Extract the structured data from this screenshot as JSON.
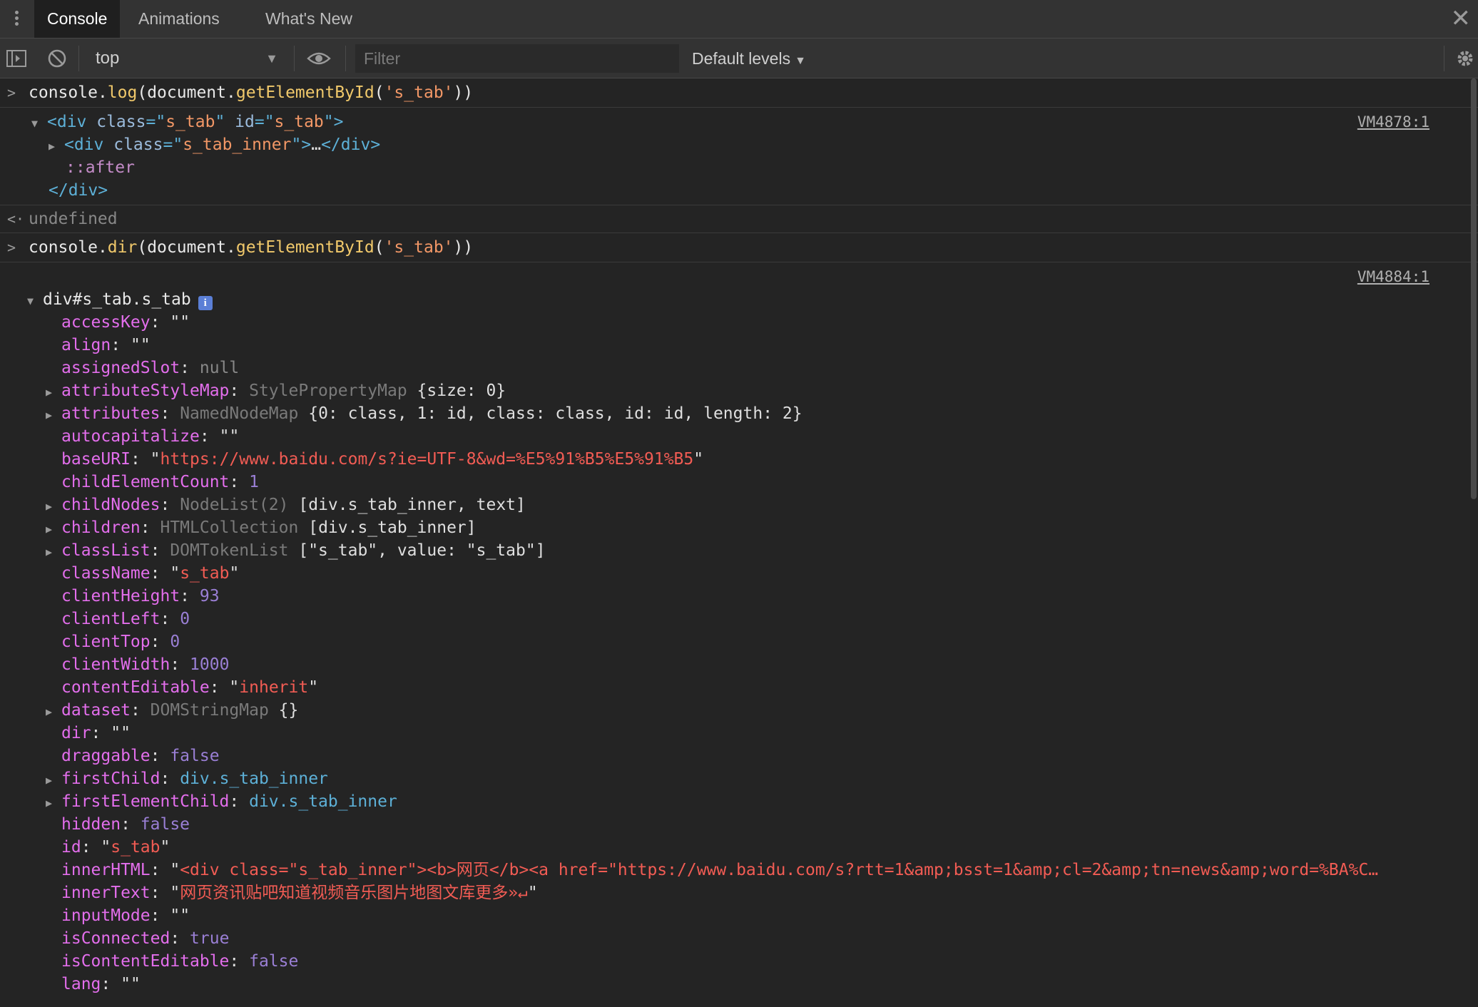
{
  "tabs": {
    "console": "Console",
    "animations": "Animations",
    "whats_new": "What's New"
  },
  "toolbar": {
    "context": "top",
    "filter_placeholder": "Filter",
    "levels": "Default levels"
  },
  "messages": {
    "cmd1": {
      "console": "console",
      "dot": ".",
      "method": "log",
      "paren": "(",
      "document": "document",
      "dot2": ".",
      "getter": "getElementById",
      "paren2": "(",
      "arg": "'s_tab'",
      "close": "))"
    },
    "out1": {
      "source": "VM4878:1",
      "l1_open": "<div",
      "l1_class_attr": " class",
      "l1_eq1": "=\"",
      "l1_class_val": "s_tab",
      "l1_q1": "\"",
      "l1_id_attr": " id",
      "l1_eq2": "=\"",
      "l1_id_val": "s_tab",
      "l1_end": "\">",
      "l2_open": "<div",
      "l2_class_attr": " class",
      "l2_eq": "=\"",
      "l2_class_val": "s_tab_inner",
      "l2_end": "\">",
      "l2_ellipsis": "…",
      "l2_close": "</div>",
      "l3": "::after",
      "l4": "</div>"
    },
    "ret1": "undefined",
    "cmd2": {
      "console": "console",
      "dot": ".",
      "method": "dir",
      "paren": "(",
      "document": "document",
      "dot2": ".",
      "getter": "getElementById",
      "paren2": "(",
      "arg": "'s_tab'",
      "close": "))"
    },
    "out2": {
      "source": "VM4884:1",
      "head": "div#s_tab.s_tab"
    }
  },
  "props": [
    {
      "key": "accessKey",
      "kind": "str",
      "val": ""
    },
    {
      "key": "align",
      "kind": "str",
      "val": ""
    },
    {
      "key": "assignedSlot",
      "kind": "null",
      "val": "null"
    },
    {
      "key": "attributeStyleMap",
      "kind": "obj",
      "expand": true,
      "ctor": "StylePropertyMap",
      "body": "{size: 0}"
    },
    {
      "key": "attributes",
      "kind": "obj",
      "expand": true,
      "ctor": "NamedNodeMap",
      "body": "{0: class, 1: id, class: class, id: id, length: 2}"
    },
    {
      "key": "autocapitalize",
      "kind": "str",
      "val": ""
    },
    {
      "key": "baseURI",
      "kind": "str",
      "val": "https://www.baidu.com/s?ie=UTF-8&wd=%E5%91%B5%E5%91%B5"
    },
    {
      "key": "childElementCount",
      "kind": "num",
      "val": "1"
    },
    {
      "key": "childNodes",
      "kind": "obj",
      "expand": true,
      "ctor": "NodeList(2)",
      "body": "[div.s_tab_inner, text]"
    },
    {
      "key": "children",
      "kind": "obj",
      "expand": true,
      "ctor": "HTMLCollection",
      "body": "[div.s_tab_inner]"
    },
    {
      "key": "classList",
      "kind": "obj",
      "expand": true,
      "ctor": "DOMTokenList",
      "body": "[\"s_tab\", value: \"s_tab\"]"
    },
    {
      "key": "className",
      "kind": "str",
      "val": "s_tab"
    },
    {
      "key": "clientHeight",
      "kind": "num",
      "val": "93"
    },
    {
      "key": "clientLeft",
      "kind": "num",
      "val": "0"
    },
    {
      "key": "clientTop",
      "kind": "num",
      "val": "0"
    },
    {
      "key": "clientWidth",
      "kind": "num",
      "val": "1000"
    },
    {
      "key": "contentEditable",
      "kind": "str",
      "val": "inherit"
    },
    {
      "key": "dataset",
      "kind": "obj",
      "expand": true,
      "ctor": "DOMStringMap",
      "body": "{}"
    },
    {
      "key": "dir",
      "kind": "str",
      "val": ""
    },
    {
      "key": "draggable",
      "kind": "bool",
      "val": "false"
    },
    {
      "key": "firstChild",
      "kind": "node",
      "expand": true,
      "val": "div.s_tab_inner"
    },
    {
      "key": "firstElementChild",
      "kind": "node",
      "expand": true,
      "val": "div.s_tab_inner"
    },
    {
      "key": "hidden",
      "kind": "bool",
      "val": "false"
    },
    {
      "key": "id",
      "kind": "str",
      "val": "s_tab"
    },
    {
      "key": "innerHTML",
      "kind": "str",
      "val": "<div class=\"s_tab_inner\"><b>网页</b><a href=\"https://www.baidu.com/s?rtt=1&amp;bsst=1&amp;cl=2&amp;tn=news&amp;word=%BA%C…",
      "noclose": true
    },
    {
      "key": "innerText",
      "kind": "str",
      "val": "网页资讯贴吧知道视频音乐图片地图文库更多»↵"
    },
    {
      "key": "inputMode",
      "kind": "str",
      "val": ""
    },
    {
      "key": "isConnected",
      "kind": "bool",
      "val": "true"
    },
    {
      "key": "isContentEditable",
      "kind": "bool",
      "val": "false"
    },
    {
      "key": "lang",
      "kind": "str",
      "val": ""
    }
  ]
}
